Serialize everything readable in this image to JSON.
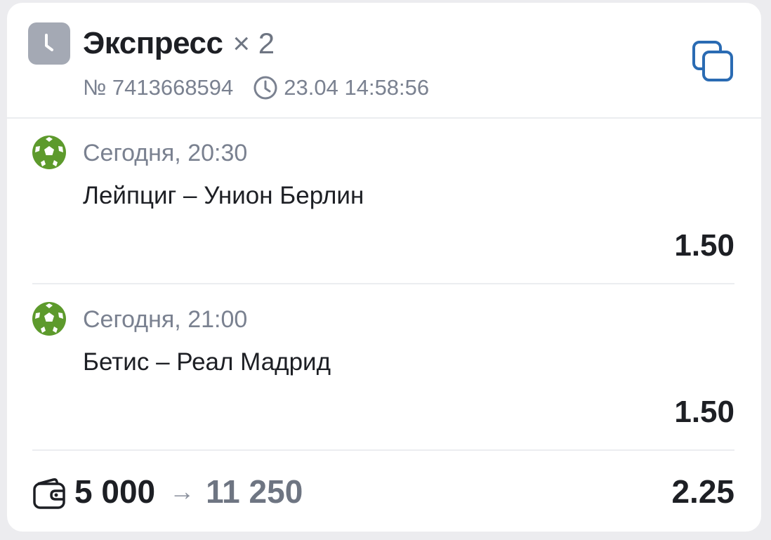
{
  "header": {
    "title": "Экспресс",
    "multiplier": "× 2",
    "bet_number": "№ 7413668594",
    "datetime": "23.04 14:58:56",
    "badge_icon": "clock-icon",
    "copy_icon": "copy-icon",
    "badge_color": "#a4a9b4",
    "accent_color": "#2a6bb3"
  },
  "events": [
    {
      "sport_icon": "football-icon",
      "time": "Сегодня, 20:30",
      "teams": "Лейпциг – Унион Берлин",
      "odd": "1.50"
    },
    {
      "sport_icon": "football-icon",
      "time": "Сегодня, 21:00",
      "teams": "Бетис – Реал Мадрид",
      "odd": "1.50"
    }
  ],
  "footer": {
    "wallet_icon": "wallet-icon",
    "stake": "5 000",
    "arrow": "→",
    "payout": "11 250",
    "total_odd": "2.25"
  },
  "colors": {
    "sport_green": "#5d9a2c",
    "text_primary": "#1d1f24",
    "text_secondary": "#7a8190"
  }
}
